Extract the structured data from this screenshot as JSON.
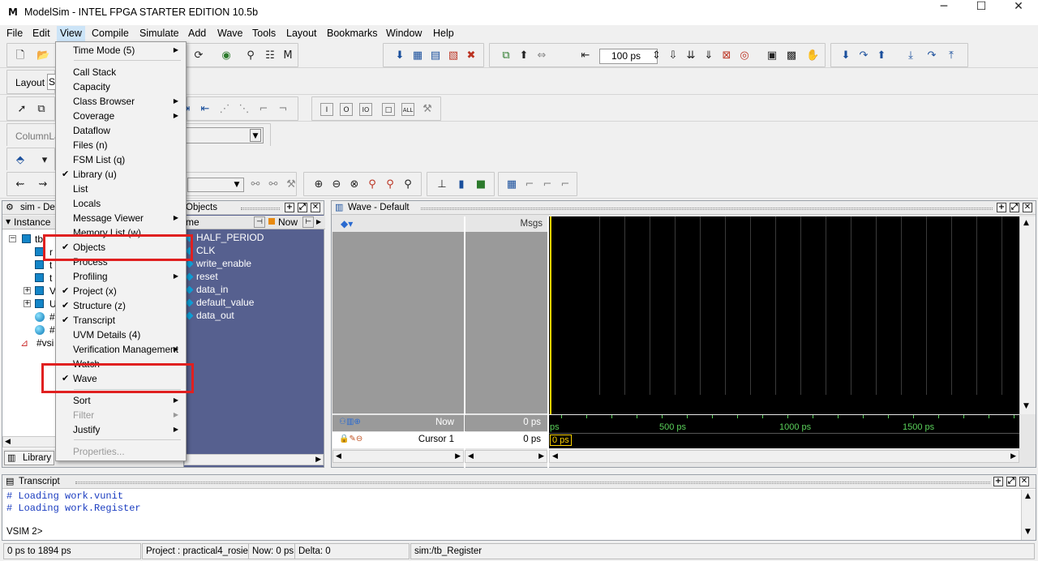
{
  "window": {
    "title": "ModelSim - INTEL FPGA STARTER EDITION 10.5b",
    "minimize": "─",
    "maximize": "☐",
    "close": "✕"
  },
  "menubar": [
    "File",
    "Edit",
    "View",
    "Compile",
    "Simulate",
    "Add",
    "Wave",
    "Tools",
    "Layout",
    "Bookmarks",
    "Window",
    "Help"
  ],
  "toolbar": {
    "layout_label": "Layout",
    "layout_value": "S",
    "columnlayout_label": "ColumnLay",
    "runlength_value": "100 ps"
  },
  "view_menu": [
    {
      "label": "Time Mode (5)",
      "submenu": true
    },
    {
      "label": "Call Stack"
    },
    {
      "label": "Capacity"
    },
    {
      "label": "Class Browser",
      "submenu": true
    },
    {
      "label": "Coverage",
      "submenu": true
    },
    {
      "label": "Dataflow"
    },
    {
      "label": "Files (n)"
    },
    {
      "label": "FSM List (q)"
    },
    {
      "label": "Library (u)",
      "checked": true
    },
    {
      "label": "List"
    },
    {
      "label": "Locals"
    },
    {
      "label": "Message Viewer",
      "submenu": true
    },
    {
      "label": "Memory List (w)"
    },
    {
      "label": "Objects",
      "checked": true
    },
    {
      "label": "Process"
    },
    {
      "label": "Profiling",
      "submenu": true
    },
    {
      "label": "Project (x)",
      "checked": true
    },
    {
      "label": "Structure  (z)",
      "checked": true
    },
    {
      "label": "Transcript",
      "checked": true
    },
    {
      "label": "UVM Details (4)"
    },
    {
      "label": "Verification Management",
      "submenu": true
    },
    {
      "label": "Watch"
    },
    {
      "label": "Wave",
      "checked": true
    },
    {
      "label": "Sort",
      "submenu": true
    },
    {
      "label": "Filter",
      "submenu": true,
      "disabled": true
    },
    {
      "label": "Justify",
      "submenu": true
    },
    {
      "label": "Properties...",
      "disabled": true
    }
  ],
  "sim_pane": {
    "title": "sim - Defa",
    "col_instance": "Instance",
    "tree": [
      "tb",
      "r",
      "t",
      "t",
      "V",
      "U",
      "#",
      "#",
      "#vsi"
    ],
    "tab_library": "Library"
  },
  "objects_pane": {
    "title": "Objects",
    "col_name": "me",
    "col_now": "Now",
    "signals": [
      "HALF_PERIOD",
      "CLK",
      "write_enable",
      "reset",
      "data_in",
      "default_value",
      "data_out"
    ]
  },
  "wave_pane": {
    "title": "Wave - Default",
    "msgs_label": "Msgs",
    "now_label": "Now",
    "now_value": "0 ps",
    "cursor_label": "Cursor 1",
    "cursor_value": "0 ps",
    "cursor_flag": "0 ps",
    "time_labels": [
      "ps",
      "500 ps",
      "1000 ps",
      "1500 ps"
    ]
  },
  "transcript": {
    "title": "Transcript",
    "lines": [
      "# Loading work.vunit",
      "# Loading work.Register"
    ],
    "prompt": "VSIM 2>"
  },
  "statusbar": {
    "range": "0 ps to 1894 ps",
    "project": "Project : practical4_rosie",
    "now": "Now: 0 ps",
    "delta": "Delta: 0",
    "context": "sim:/tb_Register"
  }
}
